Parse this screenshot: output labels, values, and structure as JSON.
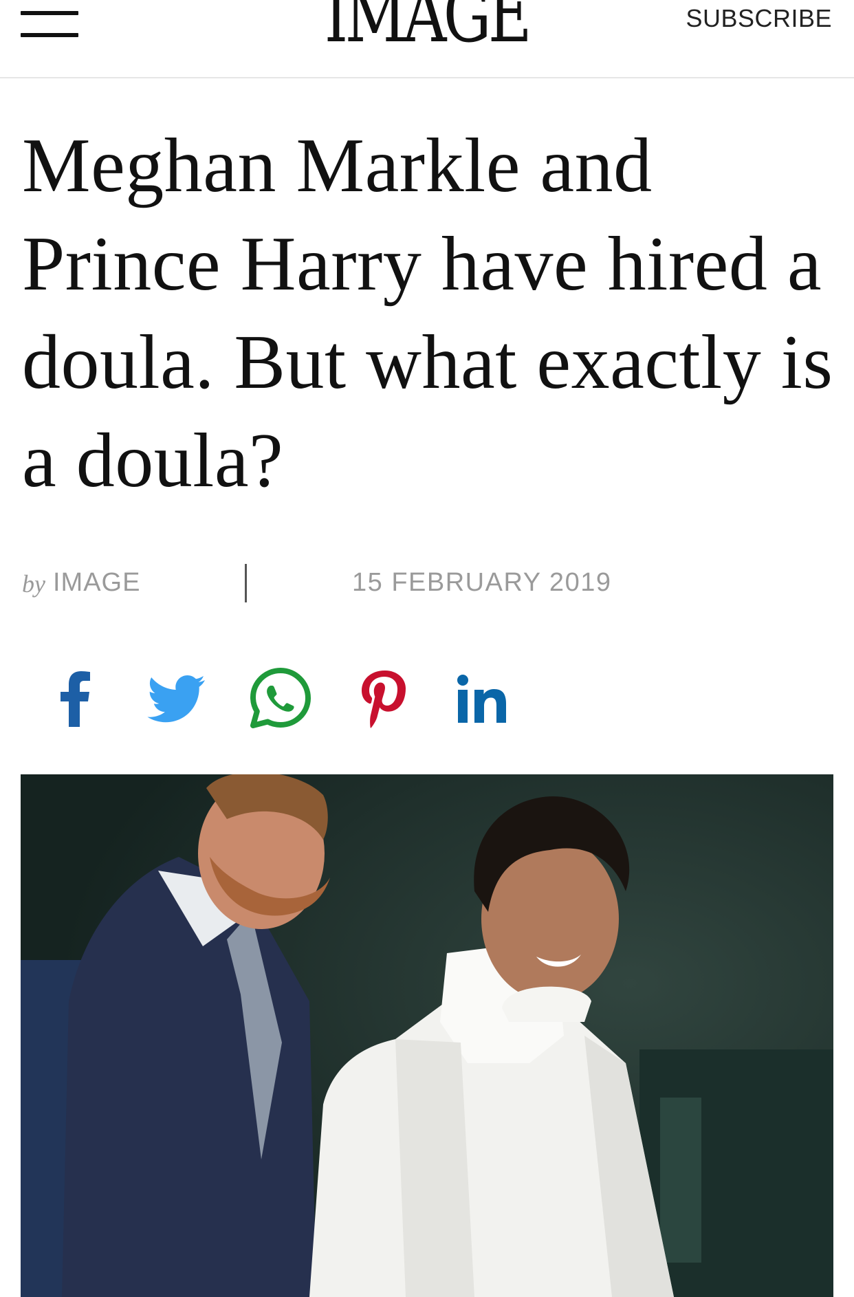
{
  "header": {
    "logo": "IMAGE",
    "subscribe_label": "SUBSCRIBE"
  },
  "article": {
    "title": "Meghan Markle and Prince Harry have hired a doula. But what exactly is a doula?",
    "byline_prefix": "by",
    "author": "IMAGE",
    "date": "15 FEBRUARY 2019"
  },
  "share": [
    {
      "name": "facebook-icon",
      "color": "#1d5fa6"
    },
    {
      "name": "twitter-icon",
      "color": "#3aa1f2"
    },
    {
      "name": "whatsapp-icon",
      "color": "#1f9a3a"
    },
    {
      "name": "pinterest-icon",
      "color": "#c8102e"
    },
    {
      "name": "linkedin-icon",
      "color": "#0a66a8"
    }
  ]
}
